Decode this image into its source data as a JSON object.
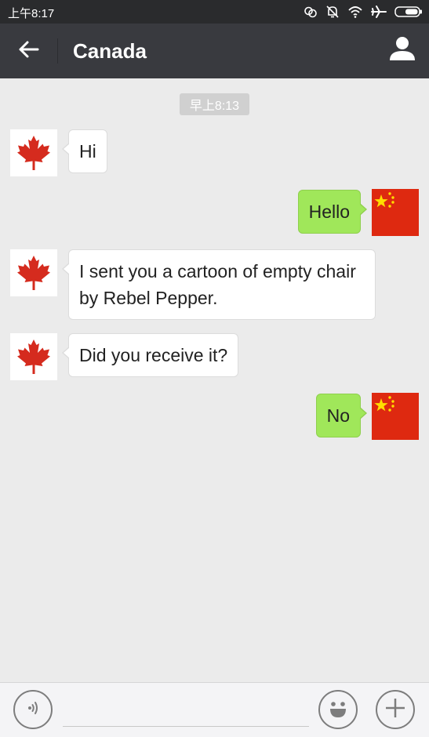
{
  "status_bar": {
    "time": "上午8:17",
    "icons": [
      "link-icon",
      "bell-muted-icon",
      "wifi-icon",
      "airplane-icon",
      "battery-icon"
    ]
  },
  "header": {
    "title": "Canada",
    "color": "#393a3f"
  },
  "chat": {
    "time_label": "早上8:13",
    "messages": [
      {
        "sender": "Canada",
        "side": "left",
        "avatar": "canada-flag",
        "text": "Hi"
      },
      {
        "sender": "self",
        "side": "right",
        "avatar": "china-flag",
        "text": "Hello"
      },
      {
        "sender": "Canada",
        "side": "left",
        "avatar": "canada-flag",
        "text": "I sent you a cartoon of empty chair by Rebel Pepper."
      },
      {
        "sender": "Canada",
        "side": "left",
        "avatar": "canada-flag",
        "text": "Did you receive it?"
      },
      {
        "sender": "self",
        "side": "right",
        "avatar": "china-flag",
        "text": "No"
      }
    ]
  },
  "input_bar": {
    "message_value": "",
    "buttons": [
      "voice-icon",
      "emoji-icon",
      "plus-icon"
    ]
  },
  "colors": {
    "background": "#ebebeb",
    "outgoing_bubble": "#a0e75a",
    "incoming_bubble": "#ffffff",
    "canada_red": "#d52b1e",
    "china_red": "#de2910",
    "china_yellow": "#ffde00"
  }
}
